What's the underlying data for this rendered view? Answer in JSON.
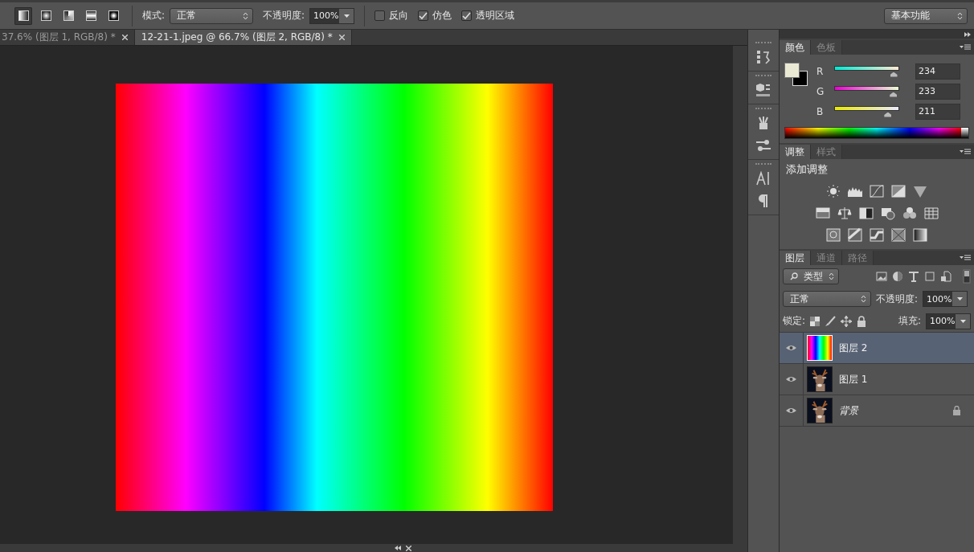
{
  "options_bar": {
    "gradient_types": [
      {
        "kind": "linear",
        "selected": true
      },
      {
        "kind": "radial",
        "selected": false
      },
      {
        "kind": "angle",
        "selected": false
      },
      {
        "kind": "reflected",
        "selected": false
      },
      {
        "kind": "diamond",
        "selected": false
      }
    ],
    "mode_label": "模式:",
    "mode_value": "正常",
    "opacity_label": "不透明度:",
    "opacity_value": "100%",
    "checkboxes": [
      {
        "label": "反向",
        "checked": false
      },
      {
        "label": "仿色",
        "checked": true
      },
      {
        "label": "透明区域",
        "checked": true
      }
    ],
    "workspace": "基本功能"
  },
  "document_tabs": [
    {
      "label": "37.6% (图层 1, RGB/8) *",
      "selected": false
    },
    {
      "label": "12-21-1.jpeg @ 66.7% (图层 2, RGB/8) *",
      "selected": true
    }
  ],
  "color_panel": {
    "tabs": [
      {
        "label": "颜色",
        "selected": true
      },
      {
        "label": "色板",
        "selected": false
      }
    ],
    "channels": [
      {
        "label": "R",
        "value": "234",
        "level": 0.918
      },
      {
        "label": "G",
        "value": "233",
        "level": 0.914
      },
      {
        "label": "B",
        "value": "211",
        "level": 0.827
      }
    ]
  },
  "adjustments_panel": {
    "tabs": [
      {
        "label": "调整",
        "selected": true
      },
      {
        "label": "样式",
        "selected": false
      }
    ],
    "heading": "添加调整"
  },
  "layers_panel": {
    "tabs": [
      {
        "label": "图层",
        "selected": true
      },
      {
        "label": "通道",
        "selected": false
      },
      {
        "label": "路径",
        "selected": false
      }
    ],
    "filter": "类型",
    "blend_mode": "正常",
    "opacity_label": "不透明度:",
    "opacity_value": "100%",
    "lock_label": "锁定:",
    "fill_label": "填充:",
    "fill_value": "100%",
    "layers": [
      {
        "name": "图层 2",
        "selected": true,
        "visible": true,
        "locked": false,
        "kind": "gradient"
      },
      {
        "name": "图层 1",
        "selected": false,
        "visible": true,
        "locked": false,
        "kind": "picture"
      },
      {
        "name": "背景",
        "selected": false,
        "visible": true,
        "locked": true,
        "kind": "picture"
      }
    ]
  }
}
